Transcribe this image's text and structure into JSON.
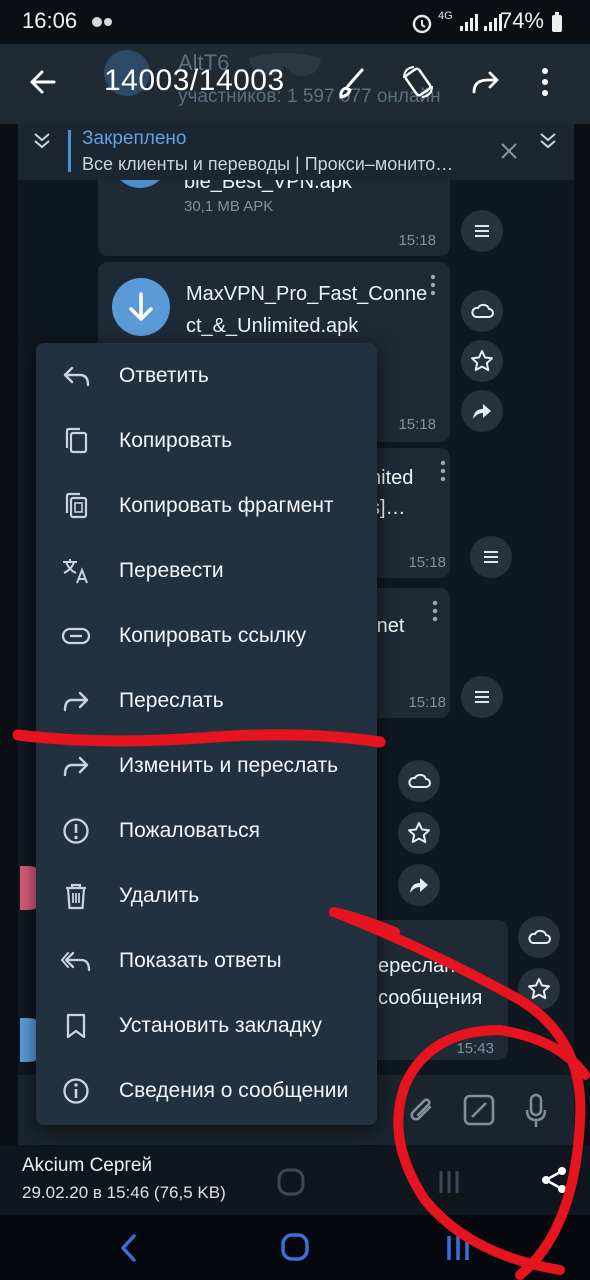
{
  "status": {
    "time": "16:06",
    "network": "4G",
    "battery": "74%"
  },
  "header": {
    "counter": "14003/14003",
    "title_behind": "AltT6",
    "subtitle_behind": "участников: 1 597 077 онлайн"
  },
  "pinned": {
    "label": "Закреплено",
    "text": "Все клиенты и переводы | Прокси–монито…"
  },
  "chat": {
    "msg1": {
      "filename": "ble_Best_VPN.apk",
      "size": "30,1 MB APK",
      "time": "15:18"
    },
    "msg2": {
      "filename_line1": "MaxVPN_Pro_Fast_Conne",
      "filename_line2": "ct_&_Unlimited.apk",
      "time": "15:18"
    },
    "msg3": {
      "text_line1": "nited",
      "text_line2": "s]…",
      "time": "15:18"
    },
    "msg4": {
      "text_line1": "rnet",
      "time": "15:18"
    },
    "msg5": {
      "text_line1": "ереслан",
      "text_line2": "сообщения",
      "time": "15:43"
    }
  },
  "menu": {
    "items": [
      {
        "label": "Ответить",
        "icon": "reply-icon"
      },
      {
        "label": "Копировать",
        "icon": "copy-icon"
      },
      {
        "label": "Копировать фрагмент",
        "icon": "copy-fragment-icon"
      },
      {
        "label": "Перевести",
        "icon": "translate-icon"
      },
      {
        "label": "Копировать ссылку",
        "icon": "link-icon"
      },
      {
        "label": "Переслать",
        "icon": "forward-icon"
      },
      {
        "label": "Изменить и переслать",
        "icon": "edit-forward-icon"
      },
      {
        "label": "Пожаловаться",
        "icon": "report-icon"
      },
      {
        "label": "Удалить",
        "icon": "trash-icon"
      },
      {
        "label": "Показать ответы",
        "icon": "replies-icon"
      },
      {
        "label": "Установить закладку",
        "icon": "bookmark-icon"
      },
      {
        "label": "Сведения о сообщении",
        "icon": "info-icon"
      }
    ]
  },
  "bottom": {
    "author": "Akcium Сергей",
    "date": "29.02.20 в 15:46 (76,5 KB)"
  },
  "colors": {
    "accent": "#4a90d9",
    "menu_bg": "#223140",
    "annotation": "#e5141f"
  }
}
